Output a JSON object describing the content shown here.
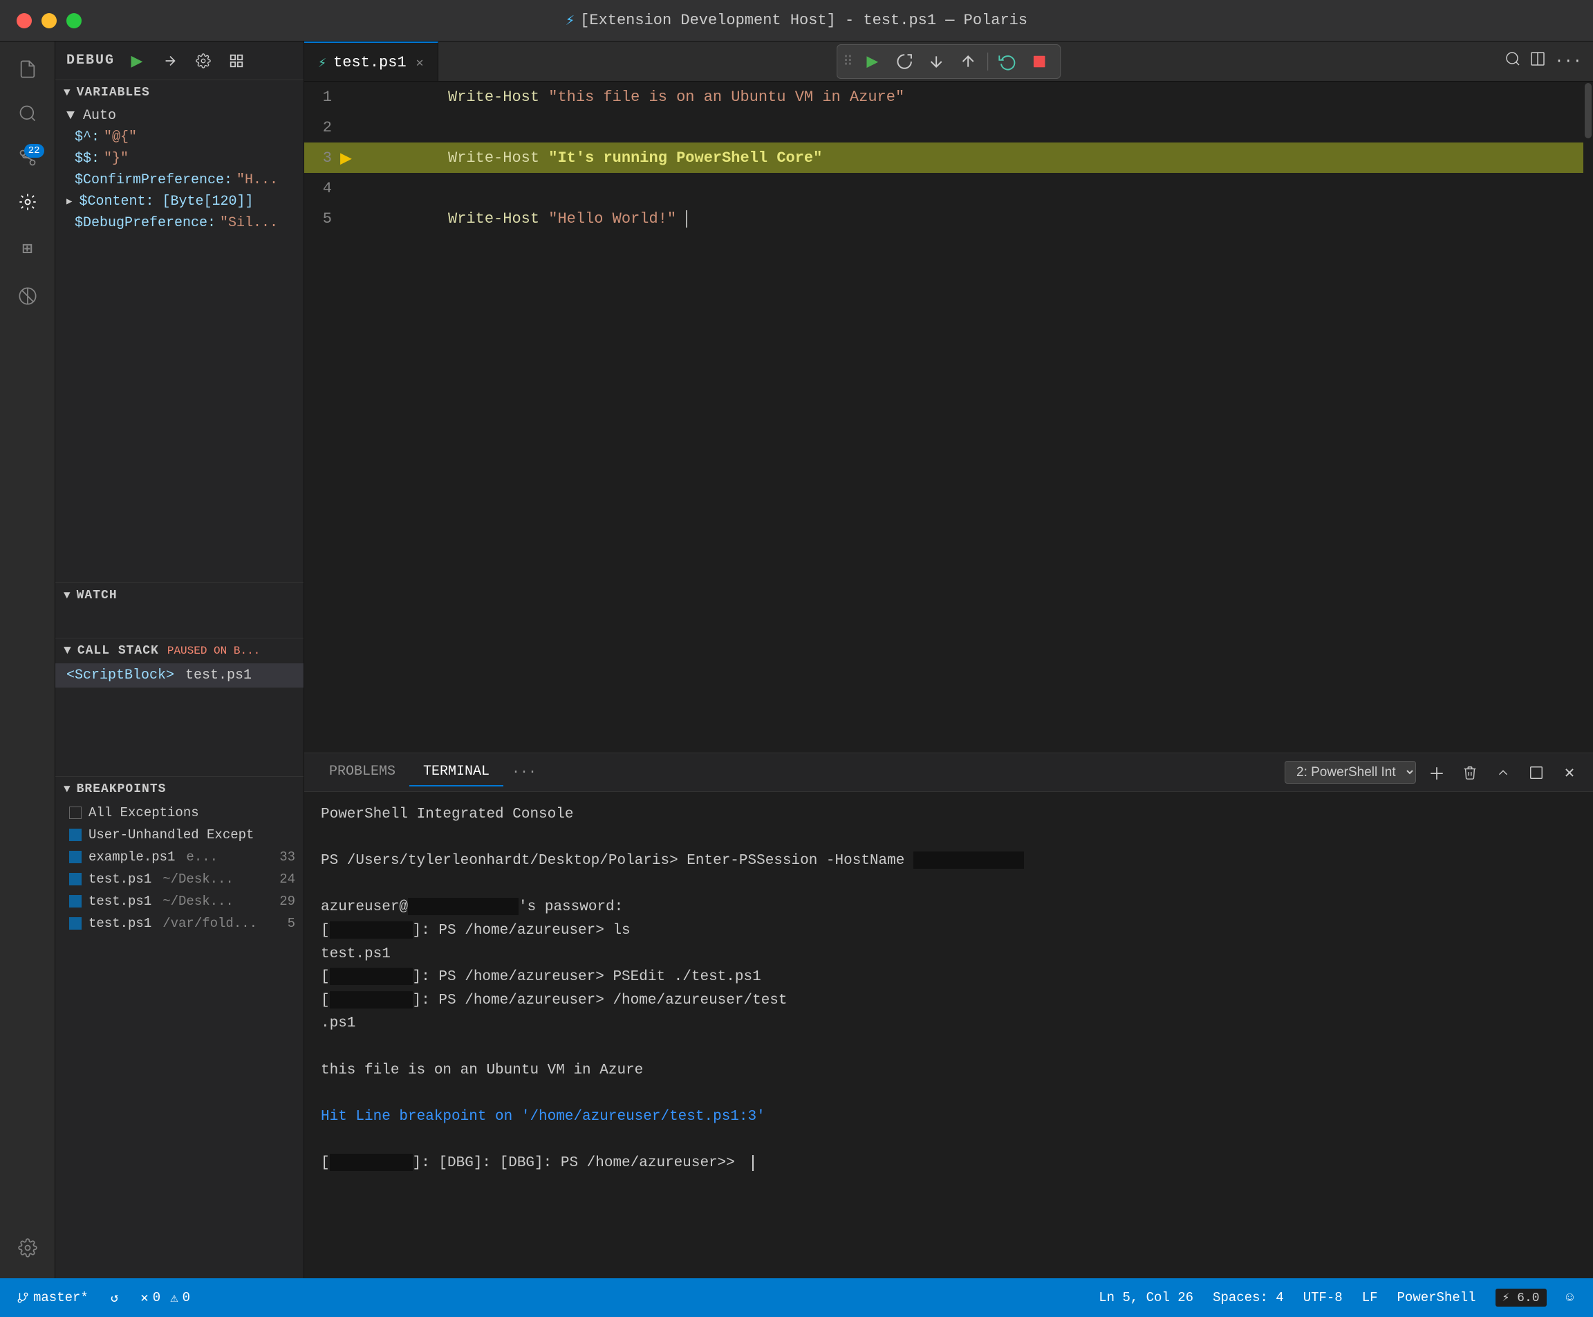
{
  "titlebar": {
    "title": "[Extension Development Host] - test.ps1 — Polaris",
    "icon": "⚡"
  },
  "activityBar": {
    "icons": [
      {
        "name": "files-icon",
        "symbol": "⎘",
        "active": false
      },
      {
        "name": "search-icon",
        "symbol": "🔍",
        "active": false
      },
      {
        "name": "source-control-icon",
        "symbol": "⑂",
        "active": false,
        "badge": "22"
      },
      {
        "name": "extensions-icon",
        "symbol": "⊞",
        "active": false
      },
      {
        "name": "remote-icon",
        "symbol": "⊗",
        "active": true
      },
      {
        "name": "settings-icon",
        "symbol": "⚙",
        "active": false,
        "position": "bottom"
      }
    ]
  },
  "sidebar": {
    "debugLabel": "DEBUG",
    "sections": {
      "variables": {
        "label": "VARIABLES",
        "autoGroup": {
          "label": "Auto",
          "items": [
            {
              "name": "$^:",
              "value": "\"@{\""
            },
            {
              "name": "$$:",
              "value": "\"}\""
            },
            {
              "name": "$ConfirmPreference:",
              "value": "\"H...\""
            },
            {
              "name": "$Content: [Byte[120]]",
              "hasExpander": true
            },
            {
              "name": "$DebugPreference:",
              "value": "\"Sil...\""
            }
          ]
        }
      },
      "watch": {
        "label": "WATCH"
      },
      "callStack": {
        "label": "CALL STACK",
        "badge": "PAUSED ON B...",
        "items": [
          {
            "name": "<ScriptBlock>",
            "file": "test.ps1"
          }
        ]
      },
      "breakpoints": {
        "label": "BREAKPOINTS",
        "items": [
          {
            "label": "All Exceptions",
            "checked": false,
            "name": "",
            "path": "",
            "line": ""
          },
          {
            "label": "User-Unhandled Except",
            "checked": true,
            "name": "",
            "path": "",
            "line": ""
          },
          {
            "label": "example.ps1",
            "checked": true,
            "path": "e...",
            "line": "33"
          },
          {
            "label": "test.ps1",
            "checked": true,
            "path": "~/Desk...",
            "line": "24"
          },
          {
            "label": "test.ps1",
            "checked": true,
            "path": "~/Desk...",
            "line": "29"
          },
          {
            "label": "test.ps1",
            "checked": true,
            "path": "/var/fold...",
            "line": "5"
          }
        ]
      }
    }
  },
  "editor": {
    "tab": {
      "icon": "⚡",
      "filename": "test.ps1",
      "modified": false
    },
    "lines": [
      {
        "num": "1",
        "tokens": [
          {
            "type": "fn",
            "text": "Write-Host"
          },
          {
            "type": "space",
            "text": " "
          },
          {
            "type": "string",
            "text": "\"this file is on an Ubuntu VM in Azure\""
          }
        ]
      },
      {
        "num": "2",
        "tokens": []
      },
      {
        "num": "3",
        "tokens": [
          {
            "type": "fn",
            "text": "Write-Host"
          },
          {
            "type": "space",
            "text": " "
          },
          {
            "type": "string-hl",
            "text": "\"It's running PowerShell Core\""
          }
        ],
        "highlighted": true,
        "debugLine": true
      },
      {
        "num": "4",
        "tokens": []
      },
      {
        "num": "5",
        "tokens": [
          {
            "type": "fn",
            "text": "Write-Host"
          },
          {
            "type": "space",
            "text": " "
          },
          {
            "type": "string",
            "text": "\"Hello World!\""
          },
          {
            "type": "cursor",
            "text": ""
          }
        ]
      }
    ]
  },
  "debugFloatBar": {
    "buttons": [
      {
        "name": "drag-handle",
        "symbol": "⣿",
        "color": "dim"
      },
      {
        "name": "continue-btn",
        "symbol": "▶",
        "color": "green"
      },
      {
        "name": "step-over-btn",
        "symbol": "↷",
        "color": "normal"
      },
      {
        "name": "step-into-btn",
        "symbol": "↓",
        "color": "normal"
      },
      {
        "name": "step-out-btn",
        "symbol": "↑",
        "color": "normal"
      },
      {
        "name": "restart-btn",
        "symbol": "↺",
        "color": "blue"
      },
      {
        "name": "stop-btn",
        "symbol": "■",
        "color": "red"
      }
    ]
  },
  "terminal": {
    "tabs": [
      {
        "label": "PROBLEMS",
        "active": false
      },
      {
        "label": "TERMINAL",
        "active": true
      }
    ],
    "dropdownLabel": "2: PowerShell Int",
    "content": {
      "header": "PowerShell Integrated Console",
      "lines": [
        {
          "text": "",
          "type": "blank"
        },
        {
          "text": "PS /Users/tylerleonhardt/Desktop/Polaris> Enter-PSSession -HostName ",
          "type": "prompt",
          "redact": true
        },
        {
          "text": "",
          "type": "blank"
        },
        {
          "text": "azureuser@",
          "type": "mixed",
          "redact": true,
          "suffix": "'s password:"
        },
        {
          "text": "[",
          "type": "mixed",
          "redact": true,
          "suffix": "]: PS /home/azureuser> ls"
        },
        {
          "text": "test.ps1",
          "type": "white"
        },
        {
          "text": "[",
          "type": "mixed",
          "redact2": true,
          "suffix": "]: PS /home/azureuser> PSEdit ./test.ps1"
        },
        {
          "text": "[",
          "type": "mixed",
          "redact3": true,
          "suffix": "]: PS /home/azureuser> /home/azureuser/test"
        },
        {
          "text": ".ps1",
          "type": "white"
        },
        {
          "text": "",
          "type": "blank"
        },
        {
          "text": "this file is on an Ubuntu VM in Azure",
          "type": "white"
        },
        {
          "text": "",
          "type": "blank"
        },
        {
          "text": "Hit Line breakpoint on '/home/azureuser/test.ps1:3'",
          "type": "link"
        },
        {
          "text": "",
          "type": "blank"
        },
        {
          "text": "[",
          "type": "mixed-dbg",
          "redact": true,
          "suffix": "]: [DBG]: [DBG]: PS /home/azureuser>> "
        }
      ]
    }
  },
  "statusBar": {
    "branch": "master*",
    "sync": "↺",
    "errors": "0",
    "warnings": "0",
    "position": "Ln 5, Col 26",
    "spaces": "Spaces: 4",
    "encoding": "UTF-8",
    "lineEnding": "LF",
    "language": "PowerShell",
    "psVersion": "⚡ 6.0",
    "smiley": "☺"
  }
}
